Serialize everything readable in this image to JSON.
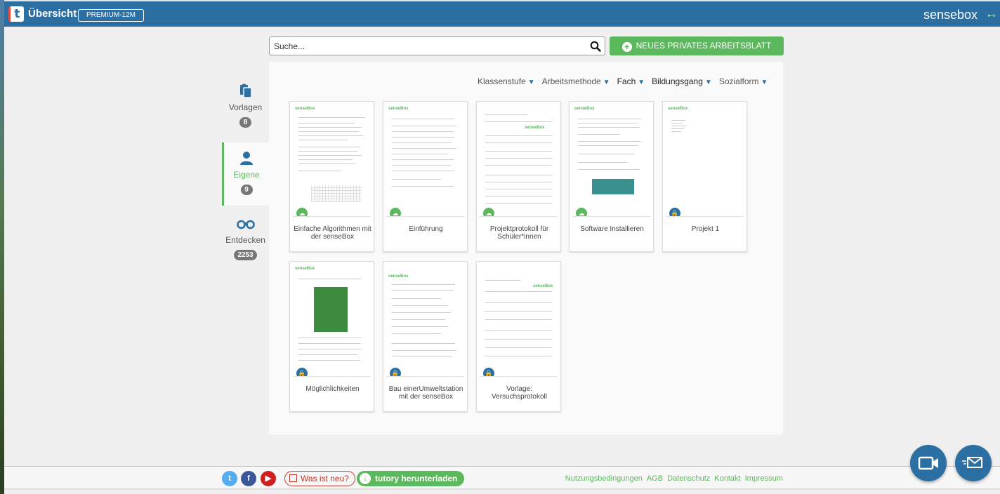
{
  "header": {
    "logo_letter": "t",
    "title": "Übersicht",
    "plan_badge": "PREMIUM-12M",
    "brand": "sensebox",
    "brand_mark": "⊷"
  },
  "search": {
    "placeholder": "Suche...",
    "value": ""
  },
  "new_button": {
    "label": "NEUES PRIVATES ARBEITSBLATT"
  },
  "sidebar": {
    "items": [
      {
        "label": "Vorlagen",
        "count": "8",
        "icon": "clipboard-icon",
        "active": false
      },
      {
        "label": "Eigene",
        "count": "9",
        "icon": "person-icon",
        "active": true
      },
      {
        "label": "Entdecken",
        "count": "2253",
        "icon": "binoculars-icon",
        "active": false
      }
    ]
  },
  "filters": [
    {
      "label": "Klassenstufe"
    },
    {
      "label": "Arbeitsmethode"
    },
    {
      "label": "Fach"
    },
    {
      "label": "Bildungsgang"
    },
    {
      "label": "Sozialform"
    }
  ],
  "worksheets": [
    {
      "title": "Einfache Algorithmen mit der senseBox",
      "status": "cloud",
      "thumb_header": "senseBox"
    },
    {
      "title": "Einführung",
      "status": "cloud",
      "thumb_header": "senseBox"
    },
    {
      "title": "Projektprotokoll für Schüler*innen",
      "status": "cloud",
      "thumb_header": "senseBox"
    },
    {
      "title": "Software Installieren",
      "status": "cloud",
      "thumb_header": "senseBox"
    },
    {
      "title": "Projekt 1",
      "status": "lock",
      "thumb_header": "senseBox"
    },
    {
      "title": "Möglichlichkeiten",
      "status": "lock",
      "thumb_header": "senseBox"
    },
    {
      "title": "Bau einerUmweltstation mit der senseBox",
      "status": "lock",
      "thumb_header": "senseBox"
    },
    {
      "title": "Vorlage: Versuchsprotokoll",
      "status": "lock",
      "thumb_header": "senseBox"
    }
  ],
  "footer": {
    "social": [
      "twitter-icon",
      "facebook-icon",
      "youtube-icon"
    ],
    "whats_new": "Was ist neu?",
    "download": "tutory herunterladen",
    "links": [
      "Nutzungsbedingungen",
      "AGB",
      "Datenschutz",
      "Kontakt",
      "Impressum"
    ]
  },
  "colors": {
    "header": "#2c6fa3",
    "accent_green": "#5cb85c",
    "danger": "#c0392b"
  }
}
